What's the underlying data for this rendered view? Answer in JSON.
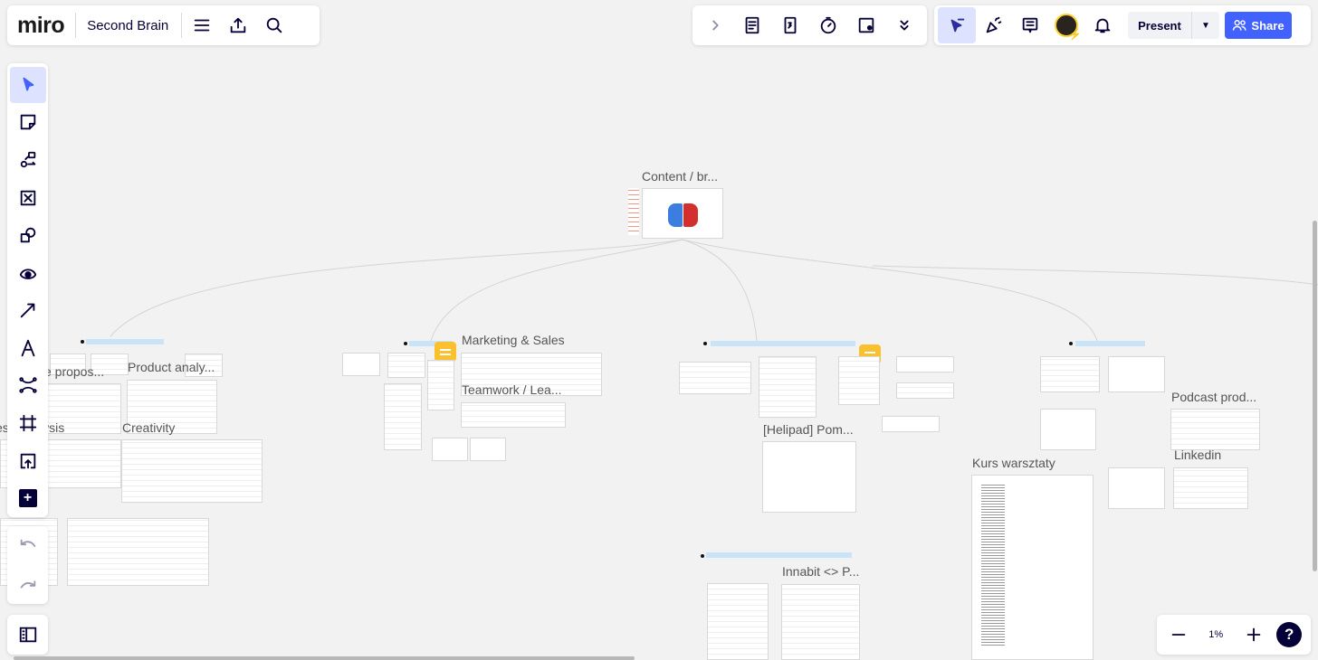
{
  "header": {
    "logo": "miro",
    "board_title": "Second Brain"
  },
  "toolbar_center": {
    "icons": [
      "chevron-right-icon",
      "notes-icon",
      "card-icon",
      "timer-icon",
      "voting-icon",
      "more-icon"
    ]
  },
  "toolbar_right": {
    "present_label": "Present",
    "share_label": "Share",
    "accent": "#4262ff"
  },
  "canvas": {
    "frames": [
      {
        "label": "Content / br..."
      },
      {
        "label": "Value propos..."
      },
      {
        "label": "Product analy..."
      },
      {
        "label": "Business analysis"
      },
      {
        "label": "Creativity"
      },
      {
        "label": "Marketing & Sales"
      },
      {
        "label": "Teamwork / Lea..."
      },
      {
        "label": "[Helipad] Pom..."
      },
      {
        "label": "Kurs warsztaty"
      },
      {
        "label": "Podcast prod..."
      },
      {
        "label": "Linkedin"
      },
      {
        "label": "Innabit <> P..."
      }
    ]
  },
  "zoom": {
    "value": "1%"
  }
}
